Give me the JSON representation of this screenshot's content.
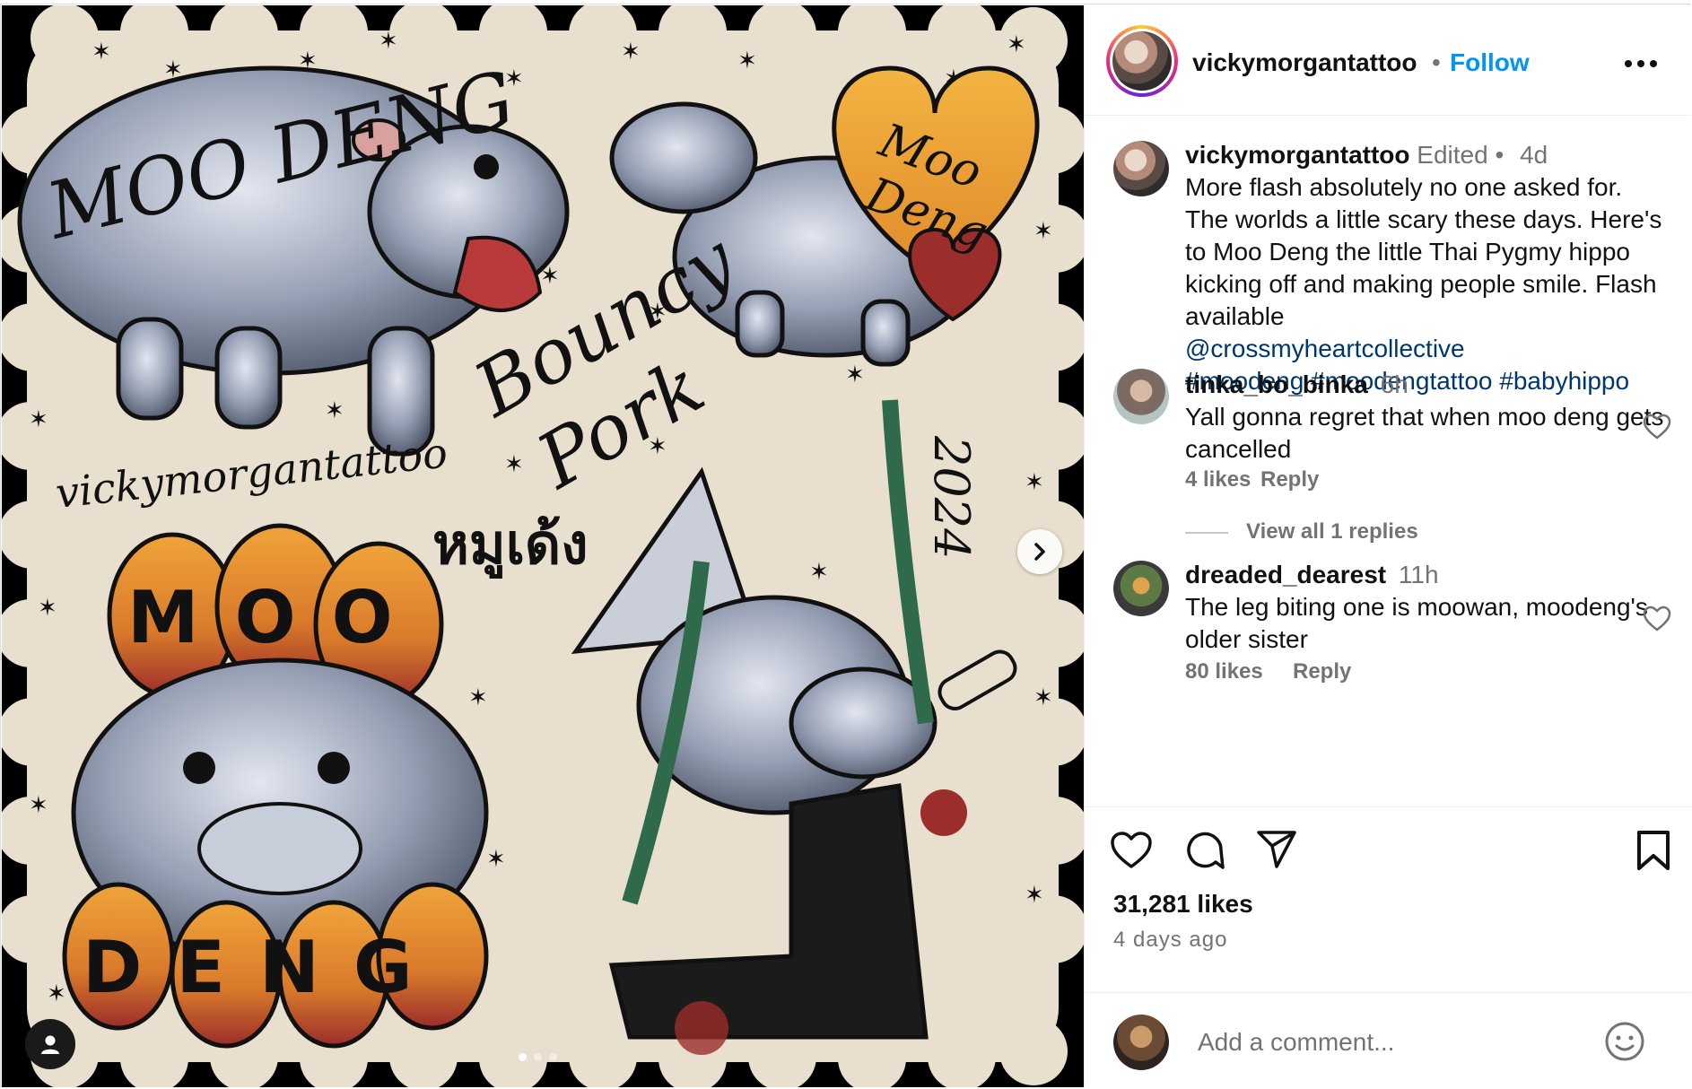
{
  "post": {
    "username": "vickymorgantattoo",
    "follow_label": "Follow",
    "more_label": "•••"
  },
  "artwork": {
    "title_text": "MOO DENG",
    "heart_text_1": "Moo",
    "heart_text_2": "Deng",
    "script_1": "Bouncy",
    "script_2": "Pork",
    "signature": "vickymorgantattoo",
    "thai_text": "หมูเด้ง",
    "year": "2024",
    "bottom_top": "MOO",
    "bottom_bottom": "DENG"
  },
  "caption": {
    "username": "vickymorgantattoo",
    "edited": "Edited",
    "dot": "•",
    "time": "4d",
    "text": "More flash absolutely no one asked for. The worlds a little scary these days. Here's to Moo Deng the little Thai Pygmy hippo kicking off and making people smile. Flash available",
    "mention": "@crossmyheartcollective",
    "hashtags": "#moodeng #moodengtattoo #babyhippo"
  },
  "comments": [
    {
      "username": "tinka_bo_binka",
      "time": "6h",
      "text": "Yall gonna regret that when moo deng gets cancelled",
      "likes": "4 likes",
      "reply": "Reply",
      "view_replies": "View all 1 replies"
    },
    {
      "username": "dreaded_dearest",
      "time": "11h",
      "text": "The leg biting one is moowan, moodeng's older sister",
      "likes": "80 likes",
      "reply": "Reply"
    }
  ],
  "stats": {
    "likes": "31,281 likes",
    "posted": "4 days ago"
  },
  "add_comment": {
    "placeholder": "Add a comment..."
  },
  "icons": [
    "heart-icon",
    "comment-icon",
    "share-icon",
    "bookmark-icon",
    "smile-icon",
    "chevron-right-icon",
    "user-tag-icon"
  ],
  "colors": {
    "accent": "#0095f6",
    "paper": "#e9dfcf",
    "hippo": "#8f98ab",
    "orange": "#e89a2c",
    "red": "#9b2d2b",
    "link": "#00376b"
  }
}
